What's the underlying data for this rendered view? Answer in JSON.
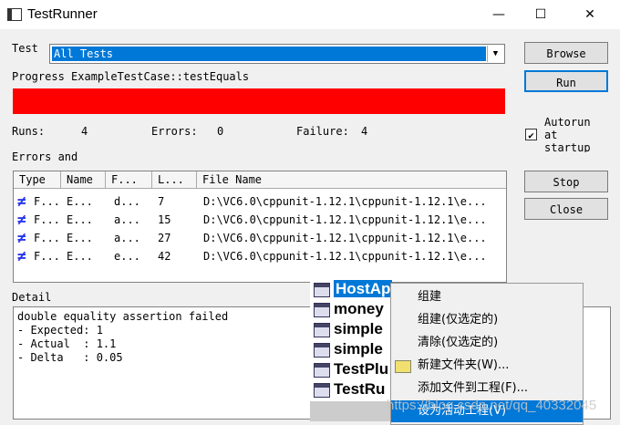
{
  "window": {
    "title": "TestRunner",
    "minimize": "—",
    "maximize": "☐",
    "close": "✕"
  },
  "test": {
    "label": "Test",
    "value": "All Tests"
  },
  "progress": {
    "label": "Progress ExampleTestCase::testEquals",
    "fraction": 1.0,
    "color": "#ff0000"
  },
  "stats": {
    "runs_label": "Runs:",
    "runs": "4",
    "errors_label": "Errors:",
    "errors": "0",
    "failure_label": "Failure:",
    "failures": "4"
  },
  "errors_label": "Errors and",
  "columns": [
    "Type",
    "Name",
    "F...",
    "L...",
    "File Name"
  ],
  "rows": [
    {
      "type": "F...",
      "name": "E...",
      "f": "d...",
      "line": "7",
      "file": "D:\\VC6.0\\cppunit-1.12.1\\cppunit-1.12.1\\e..."
    },
    {
      "type": "F...",
      "name": "E...",
      "f": "a...",
      "line": "15",
      "file": "D:\\VC6.0\\cppunit-1.12.1\\cppunit-1.12.1\\e..."
    },
    {
      "type": "F...",
      "name": "E...",
      "f": "a...",
      "line": "27",
      "file": "D:\\VC6.0\\cppunit-1.12.1\\cppunit-1.12.1\\e..."
    },
    {
      "type": "F...",
      "name": "E...",
      "f": "e...",
      "line": "42",
      "file": "D:\\VC6.0\\cppunit-1.12.1\\cppunit-1.12.1\\e..."
    }
  ],
  "detail": {
    "label": "Detail",
    "text": "double equality assertion failed\n- Expected: 1\n- Actual  : 1.1\n- Delta   : 0.05"
  },
  "buttons": {
    "browse": "Browse",
    "run": "Run",
    "stop": "Stop",
    "close": "Close"
  },
  "autorun": {
    "label": "Autorun at startup",
    "checked": true
  },
  "tree": [
    "HostAp",
    "money",
    "simple",
    "simple",
    "TestPlu",
    "TestRu"
  ],
  "menu": [
    "组建",
    "组建(仅选定的)",
    "清除(仅选定的)",
    "新建文件夹(W)...",
    "添加文件到工程(F)...",
    "设为活动工程(V)"
  ],
  "watermark": "https://blog.csdn.net/qq_40332045"
}
